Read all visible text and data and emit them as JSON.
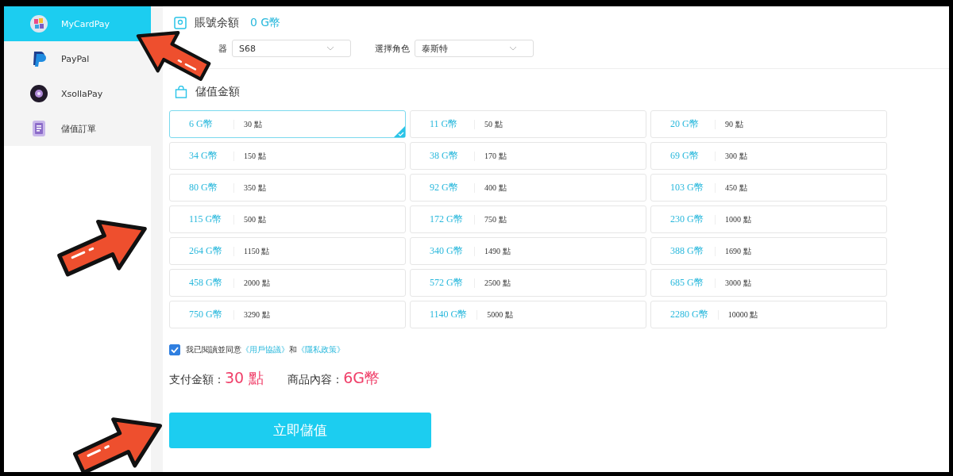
{
  "sidebar": {
    "items": [
      {
        "label": "MyCardPay",
        "selected": true
      },
      {
        "label": "PayPal",
        "selected": false
      },
      {
        "label": "XsollaPay",
        "selected": false
      },
      {
        "label": "儲值訂單",
        "selected": false
      }
    ]
  },
  "balance": {
    "label": "賬號余額",
    "value": "0 G幣"
  },
  "selects": [
    {
      "label": "器",
      "value": "S68"
    },
    {
      "label": "選擇角色",
      "value": "泰斯特"
    }
  ],
  "section_title": "儲值金額",
  "packages": [
    {
      "gold": "6 G幣",
      "points": "30 點",
      "selected": true
    },
    {
      "gold": "11 G幣",
      "points": "50 點",
      "selected": false
    },
    {
      "gold": "20 G幣",
      "points": "90 點",
      "selected": false
    },
    {
      "gold": "34 G幣",
      "points": "150 點",
      "selected": false
    },
    {
      "gold": "38 G幣",
      "points": "170 點",
      "selected": false
    },
    {
      "gold": "69 G幣",
      "points": "300 點",
      "selected": false
    },
    {
      "gold": "80 G幣",
      "points": "350 點",
      "selected": false
    },
    {
      "gold": "92 G幣",
      "points": "400 點",
      "selected": false
    },
    {
      "gold": "103 G幣",
      "points": "450 點",
      "selected": false
    },
    {
      "gold": "115 G幣",
      "points": "500 點",
      "selected": false
    },
    {
      "gold": "172 G幣",
      "points": "750 點",
      "selected": false
    },
    {
      "gold": "230 G幣",
      "points": "1000 點",
      "selected": false
    },
    {
      "gold": "264 G幣",
      "points": "1150 點",
      "selected": false
    },
    {
      "gold": "340 G幣",
      "points": "1490 點",
      "selected": false
    },
    {
      "gold": "388 G幣",
      "points": "1690 點",
      "selected": false
    },
    {
      "gold": "458 G幣",
      "points": "2000 點",
      "selected": false
    },
    {
      "gold": "572 G幣",
      "points": "2500 點",
      "selected": false
    },
    {
      "gold": "685 G幣",
      "points": "3000 點",
      "selected": false
    },
    {
      "gold": "750 G幣",
      "points": "3290 點",
      "selected": false
    },
    {
      "gold": "1140 G幣",
      "points": "5000 點",
      "selected": false
    },
    {
      "gold": "2280 G幣",
      "points": "10000 點",
      "selected": false
    }
  ],
  "agreement": {
    "checked": true,
    "text": "我已閱讀並同意",
    "link_1": "《用戶協議》",
    "joiner": "和",
    "link_2": "《隱私政策》"
  },
  "summary": {
    "pay_label": "支付金額：",
    "pay_value": "30 點",
    "item_label": "商品內容：",
    "item_value": "6G幣"
  },
  "submit_button": "立即儲值"
}
